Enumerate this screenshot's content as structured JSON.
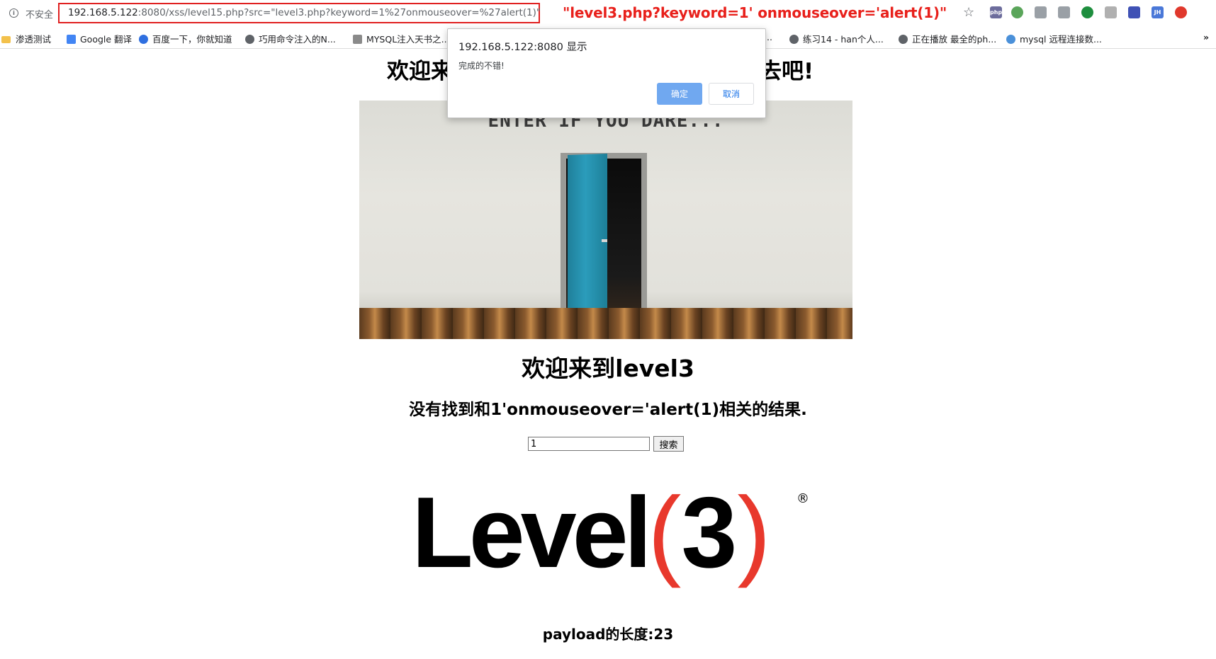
{
  "browser": {
    "security_label": "不安全",
    "url_host": "192.168.5.122",
    "url_rest": ":8080/xss/level15.php?src=\"level3.php?keyword=1%27onmouseover=%27alert(1)\"",
    "annotation": "\"level3.php?keyword=1' onmouseover='alert(1)\"",
    "extensions": [
      {
        "icon": "php-icon",
        "label": "php",
        "color": "#6c6c9c"
      },
      {
        "icon": "green-circle-icon",
        "label": "",
        "color": "#5aa55a"
      },
      {
        "icon": "bird-icon",
        "label": "",
        "color": "#9aa0a6"
      },
      {
        "icon": "link-icon",
        "label": "",
        "color": "#9aa0a6"
      },
      {
        "icon": "green-dot-icon",
        "label": "",
        "color": "#1e8e3e"
      },
      {
        "icon": "puzzle-icon",
        "label": "",
        "color": "#b0b0b0"
      },
      {
        "icon": "chart-icon",
        "label": "",
        "color": "#3f51b5"
      },
      {
        "icon": "jh-icon",
        "label": "JH",
        "color": "#4a78d8"
      },
      {
        "icon": "flash-icon",
        "label": "",
        "color": "#e0382c"
      }
    ]
  },
  "bookmarks": [
    {
      "label": "渗透测试",
      "icon": "folder-icon"
    },
    {
      "label": "Google 翻译",
      "icon": "translate-icon"
    },
    {
      "label": "百度一下，你就知道",
      "icon": "baidu-icon"
    },
    {
      "label": "巧用命令注入的N...",
      "icon": "globe-icon"
    },
    {
      "label": "MYSQL注入天书之...",
      "icon": "site-icon"
    },
    {
      "label": "...",
      "icon": ""
    },
    {
      "label": "练习14 - han个人...",
      "icon": "globe-icon"
    },
    {
      "label": "正在播放 最全的ph...",
      "icon": "globe-icon"
    },
    {
      "label": "mysql 远程连接数...",
      "icon": "cloud-icon"
    }
  ],
  "dialog": {
    "title": "192.168.5.122:8080 显示",
    "message": "完成的不错!",
    "ok_label": "确定",
    "cancel_label": "取消"
  },
  "page": {
    "top_heading_start": "欢迎来",
    "top_heading_end": "去吧!",
    "door_text": "ENTER IF YOU DARE...",
    "level_title": "欢迎来到level3",
    "result_text": "没有找到和1'onmouseover='alert(1)相关的结果.",
    "search_value": "1",
    "search_button": "搜索",
    "logo_word": "Level",
    "logo_paren_open": "(",
    "logo_number": "3",
    "logo_paren_close": ")",
    "logo_reg": "®",
    "payload_length": "payload的长度:23"
  }
}
